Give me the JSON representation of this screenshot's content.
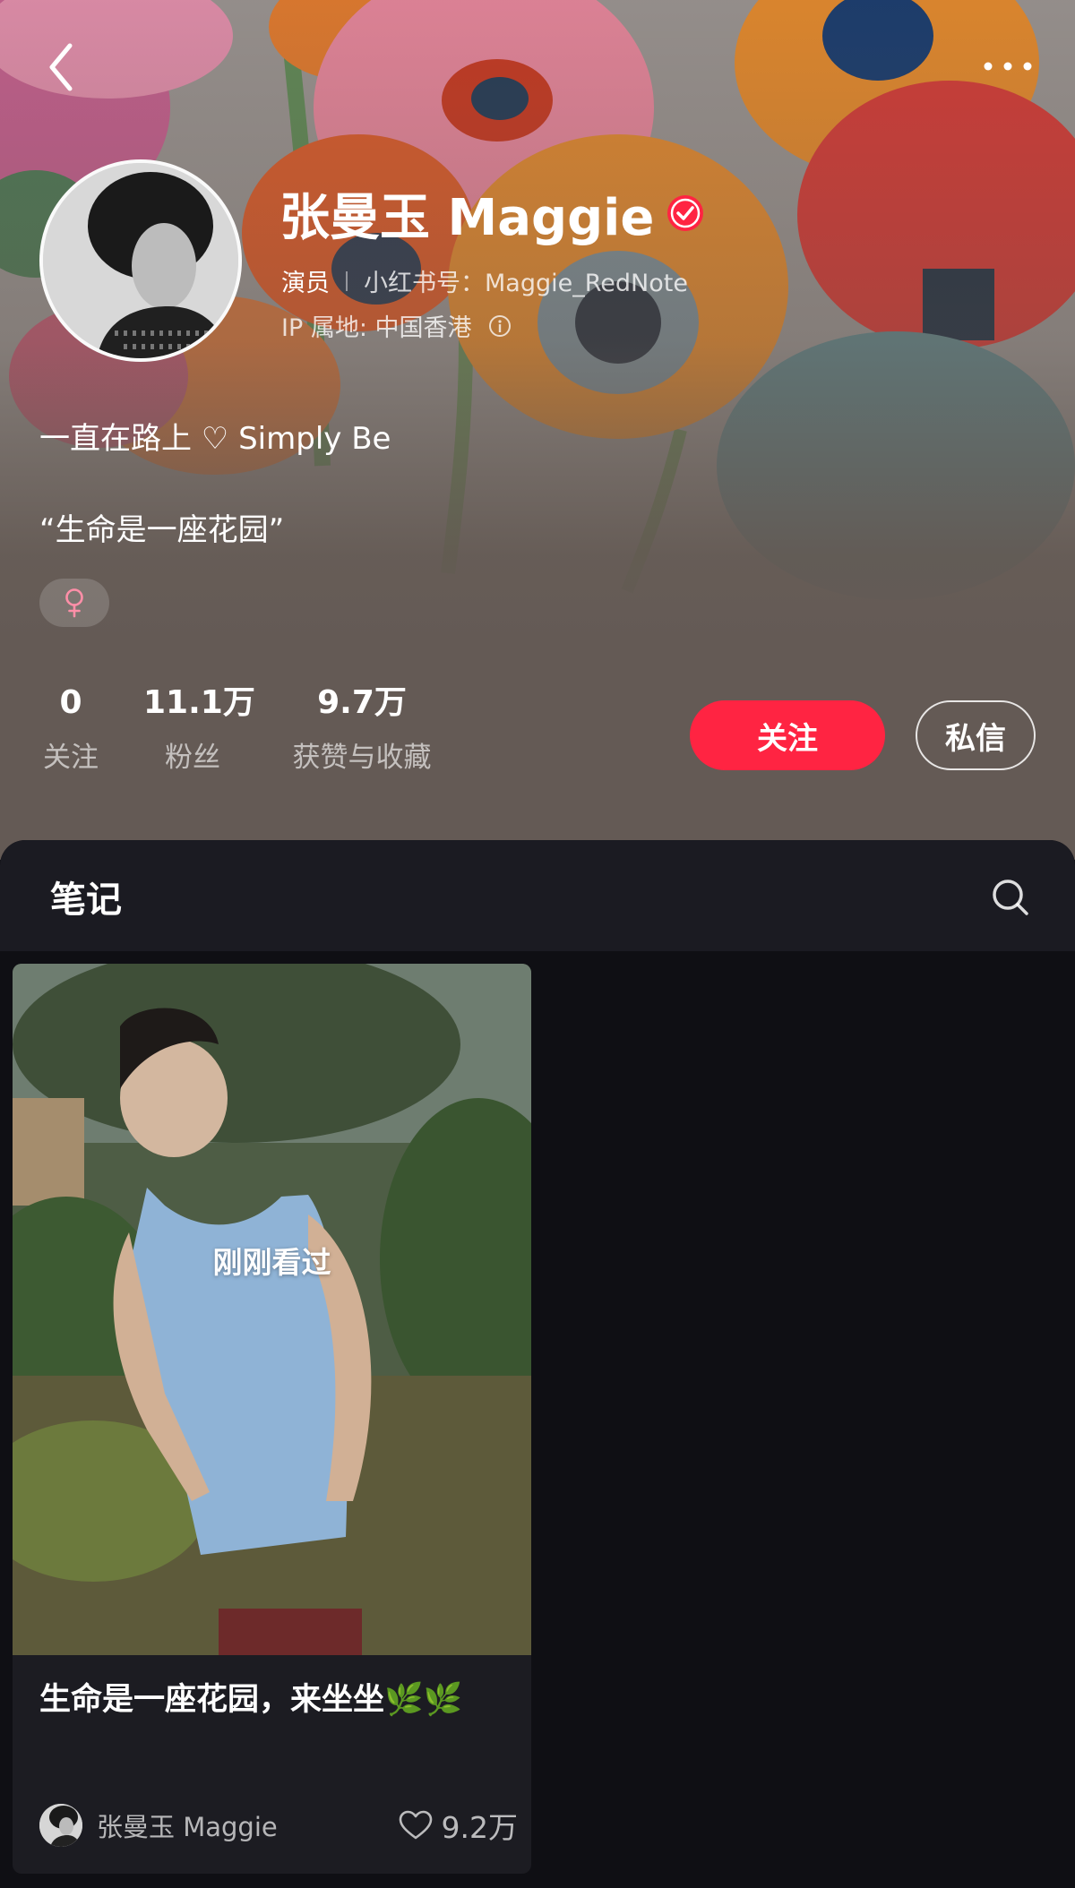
{
  "profile": {
    "name": "张曼玉 Maggie",
    "role": "演员",
    "redbook_id": "小红书号：Maggie_RedNote",
    "ip_location": "IP 属地: 中国香港",
    "bio_line1": "一直在路上 ♡ Simply Be",
    "bio_line2": "“生命是一座花园”",
    "gender_symbol": "♀",
    "verified": true
  },
  "stats": {
    "following": {
      "value": "0",
      "label": "关注"
    },
    "fans": {
      "value": "11.1万",
      "label": "粉丝"
    },
    "likes": {
      "value": "9.7万",
      "label": "获赞与收藏"
    }
  },
  "actions": {
    "follow_label": "关注",
    "message_label": "私信"
  },
  "notes": {
    "tab_label": "笔记",
    "items": [
      {
        "cover_label": "刚刚看过",
        "title": "生命是一座花园，来坐坐🌿🌿",
        "author": "张曼玉 Maggie",
        "likes": "9.2万"
      }
    ]
  },
  "colors": {
    "accent": "#ff2442",
    "header_bg": "#645a55",
    "panel_bg": "#0f0f14",
    "notes_header_bg": "#1b1b22",
    "gender_pink": "#ff8fa8"
  },
  "icons": {
    "back": "chevron-left-icon",
    "more": "more-dots-icon",
    "verified": "verified-check-icon",
    "info": "info-icon",
    "gender": "female-icon",
    "search": "search-icon",
    "like": "heart-icon"
  }
}
